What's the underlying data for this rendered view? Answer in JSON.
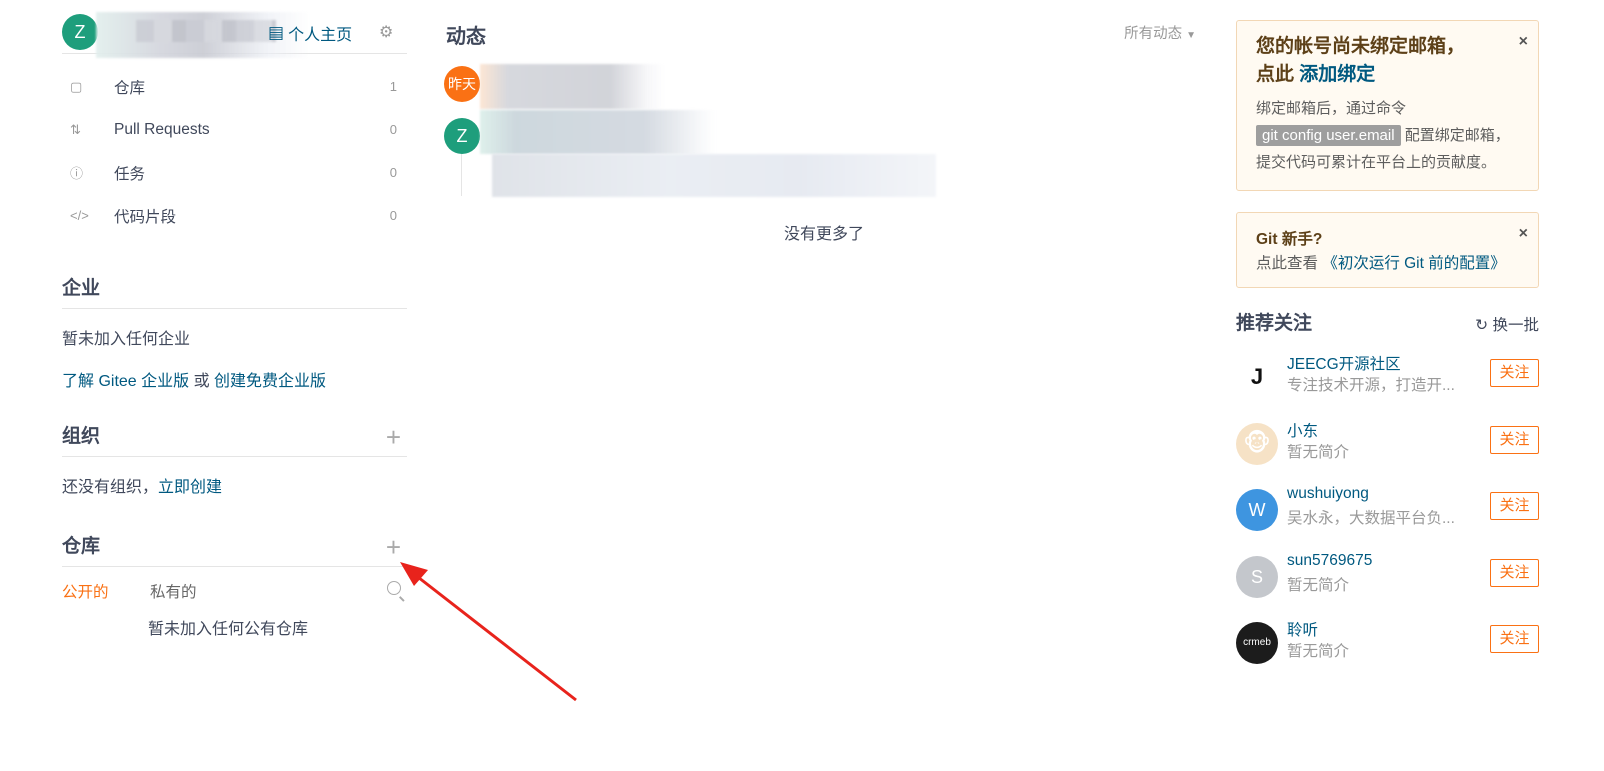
{
  "profile": {
    "avatar_letter": "Z",
    "homepage_label": "个人主页",
    "nav": [
      {
        "label": "仓库",
        "count": "1",
        "icon": "repo-icon"
      },
      {
        "label": "Pull Requests",
        "count": "0",
        "icon": "pull-request-icon"
      },
      {
        "label": "任务",
        "count": "0",
        "icon": "issue-icon"
      },
      {
        "label": "代码片段",
        "count": "0",
        "icon": "code-snippet-icon"
      }
    ]
  },
  "enterprise": {
    "title": "企业",
    "empty_text": "暂未加入任何企业",
    "learn_link": "了解 Gitee 企业版",
    "or_text": " 或 ",
    "create_link": "创建免费企业版"
  },
  "organization": {
    "title": "组织",
    "empty_text": "还没有组织，",
    "create_link": "立即创建"
  },
  "repositories": {
    "title": "仓库",
    "tab_public": "公开的",
    "tab_private": "私有的",
    "empty_text": "暂未加入任何公有仓库"
  },
  "feed": {
    "title": "动态",
    "filter_label": "所有动态",
    "yesterday_badge": "昨天",
    "avatar_letter": "Z",
    "no_more_text": "没有更多了"
  },
  "email_notice": {
    "title_line1": "您的帐号尚未绑定邮箱，",
    "title_line2_prefix": "点此 ",
    "title_link": "添加绑定",
    "body_prefix": "绑定邮箱后，通过命令",
    "code": "git config user.email",
    "body_suffix": " 配置绑定邮箱，提交代码可累计在平台上的贡献度。",
    "close": "×"
  },
  "git_notice": {
    "title": "Git 新手?",
    "body_prefix": "点此查看 ",
    "link": "《初次运行 Git 前的配置》",
    "close": "×"
  },
  "recommend": {
    "title": "推荐关注",
    "refresh_label": "换一批",
    "follow_label": "关注",
    "users": [
      {
        "name": "JEECG开源社区",
        "desc": "专注技术开源，打造开...",
        "avatar_text": "J",
        "avatar_color": "#ffffff",
        "text_color": "#111111"
      },
      {
        "name": "小东",
        "desc": "暂无简介",
        "avatar_text": "🐵",
        "avatar_color": "#ffffff",
        "text_color": "#8a5a2b"
      },
      {
        "name": "wushuiyong",
        "desc": "吴水永，大数据平台负...",
        "avatar_text": "W",
        "avatar_color": "#3e95e0",
        "text_color": "#ffffff"
      },
      {
        "name": "sun5769675",
        "desc": "暂无简介",
        "avatar_text": "S",
        "avatar_color": "#c4c7cc",
        "text_color": "#ffffff"
      },
      {
        "name": "聆听",
        "desc": "暂无简介",
        "avatar_text": "crmeb",
        "avatar_color": "#1c1c1c",
        "text_color": "#ffffff"
      }
    ]
  },
  "colors": {
    "accent_orange": "#fa7114",
    "link_blue": "#005980",
    "avatar_green": "#1e9e7c",
    "arrow_red": "#e8231c"
  }
}
